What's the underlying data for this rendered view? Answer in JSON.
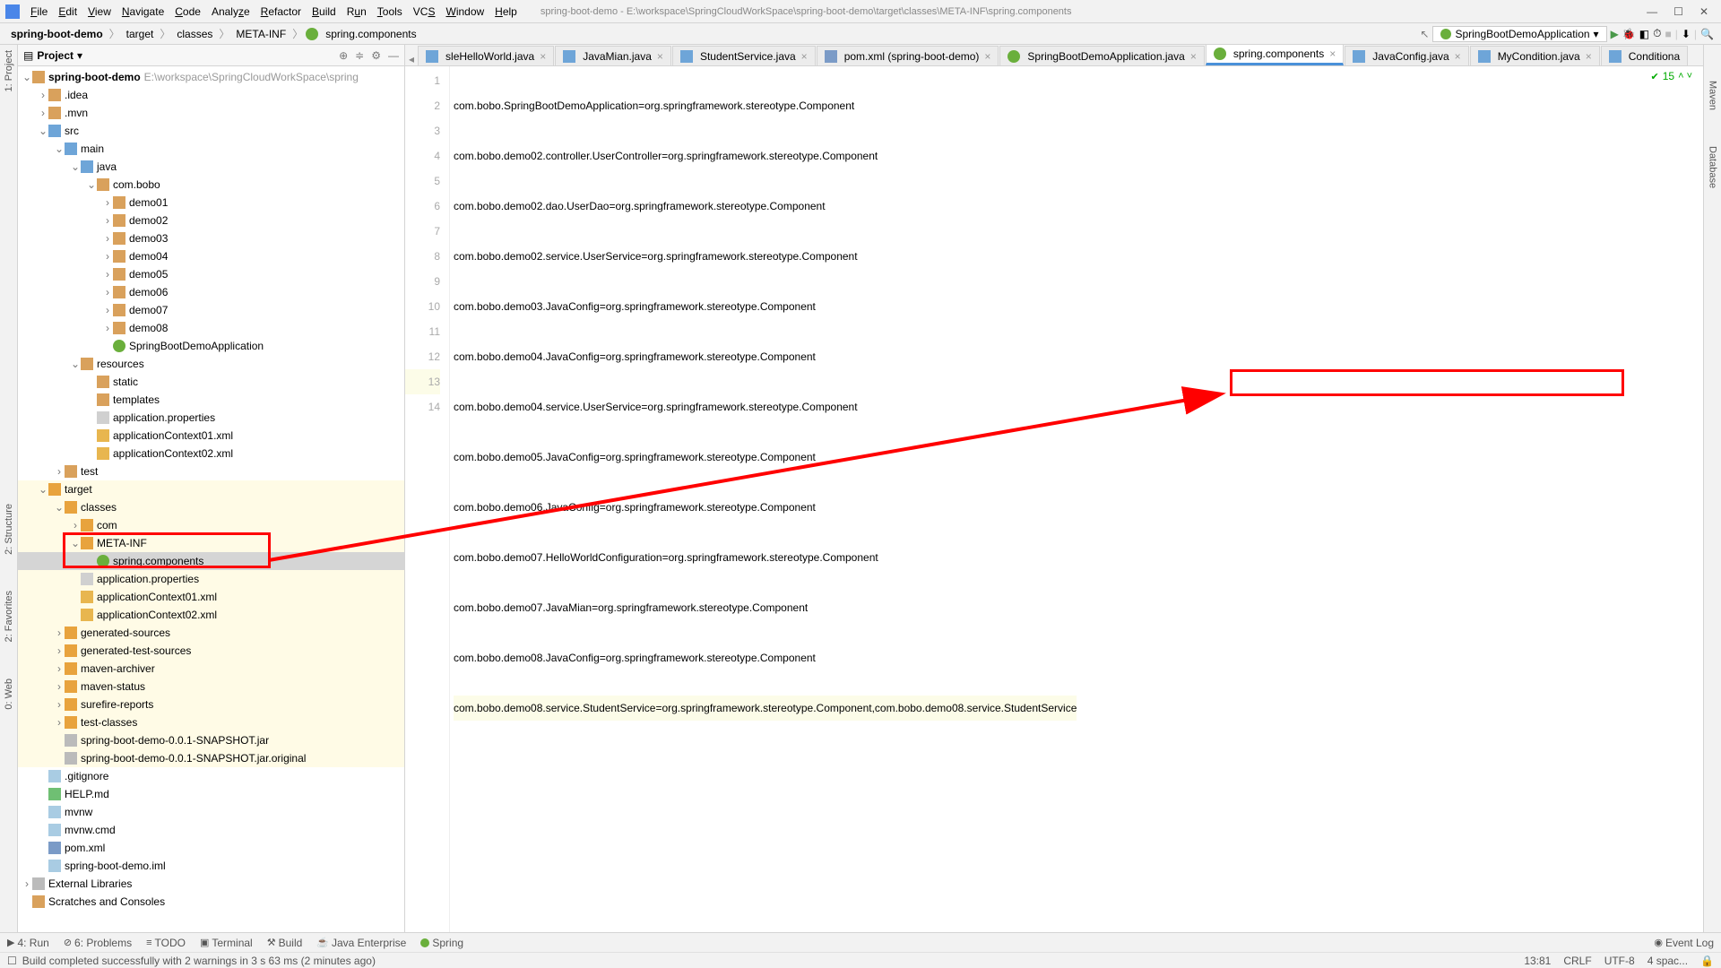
{
  "menu": [
    "File",
    "Edit",
    "View",
    "Navigate",
    "Code",
    "Analyze",
    "Refactor",
    "Build",
    "Run",
    "Tools",
    "VCS",
    "Window",
    "Help"
  ],
  "title_path": "spring-boot-demo - E:\\workspace\\SpringCloudWorkSpace\\spring-boot-demo\\target\\classes\\META-INF\\spring.components",
  "breadcrumbs": [
    "spring-boot-demo",
    "target",
    "classes",
    "META-INF",
    "spring.components"
  ],
  "run_config": "SpringBootDemoApplication",
  "project_panel_title": "Project",
  "tree": {
    "root": "spring-boot-demo",
    "root_path": "E:\\workspace\\SpringCloudWorkSpace\\spring",
    "idea": ".idea",
    "mvn": ".mvn",
    "src": "src",
    "main": "main",
    "java": "java",
    "combobo": "com.bobo",
    "demo01": "demo01",
    "demo02": "demo02",
    "demo03": "demo03",
    "demo04": "demo04",
    "demo05": "demo05",
    "demo06": "demo06",
    "demo07": "demo07",
    "demo08": "demo08",
    "sbapp": "SpringBootDemoApplication",
    "resources": "resources",
    "static": "static",
    "templates": "templates",
    "appprops": "application.properties",
    "ctx01": "applicationContext01.xml",
    "ctx02": "applicationContext02.xml",
    "test": "test",
    "target": "target",
    "classes": "classes",
    "com": "com",
    "metainf": "META-INF",
    "springcomp": "spring.components",
    "appprops2": "application.properties",
    "ctx01b": "applicationContext01.xml",
    "ctx02b": "applicationContext02.xml",
    "gensrc": "generated-sources",
    "gentest": "generated-test-sources",
    "march": "maven-archiver",
    "mstat": "maven-status",
    "sure": "surefire-reports",
    "tcls": "test-classes",
    "jar": "spring-boot-demo-0.0.1-SNAPSHOT.jar",
    "orig": "spring-boot-demo-0.0.1-SNAPSHOT.jar.original",
    "gitig": ".gitignore",
    "help": "HELP.md",
    "mvnw": "mvnw",
    "mvnwcmd": "mvnw.cmd",
    "pom": "pom.xml",
    "iml": "spring-boot-demo.iml",
    "extlib": "External Libraries",
    "scratch": "Scratches and Consoles"
  },
  "tabs": [
    {
      "label": "sleHelloWorld.java",
      "icon": "java"
    },
    {
      "label": "JavaMian.java",
      "icon": "java"
    },
    {
      "label": "StudentService.java",
      "icon": "java"
    },
    {
      "label": "pom.xml (spring-boot-demo)",
      "icon": "maven"
    },
    {
      "label": "SpringBootDemoApplication.java",
      "icon": "java"
    },
    {
      "label": "spring.components",
      "icon": "sb",
      "active": true
    },
    {
      "label": "JavaConfig.java",
      "icon": "java"
    },
    {
      "label": "MyCondition.java",
      "icon": "java"
    },
    {
      "label": "Conditiona",
      "icon": "java"
    }
  ],
  "editor_lines": [
    "com.bobo.SpringBootDemoApplication=org.springframework.stereotype.Component",
    "com.bobo.demo02.controller.UserController=org.springframework.stereotype.Component",
    "com.bobo.demo02.dao.UserDao=org.springframework.stereotype.Component",
    "com.bobo.demo02.service.UserService=org.springframework.stereotype.Component",
    "com.bobo.demo03.JavaConfig=org.springframework.stereotype.Component",
    "com.bobo.demo04.JavaConfig=org.springframework.stereotype.Component",
    "com.bobo.demo04.service.UserService=org.springframework.stereotype.Component",
    "com.bobo.demo05.JavaConfig=org.springframework.stereotype.Component",
    "com.bobo.demo06.JavaConfig=org.springframework.stereotype.Component",
    "com.bobo.demo07.HelloWorldConfiguration=org.springframework.stereotype.Component",
    "com.bobo.demo07.JavaMian=org.springframework.stereotype.Component",
    "com.bobo.demo08.JavaConfig=org.springframework.stereotype.Component",
    "com.bobo.demo08.service.StudentService=org.springframework.stereotype.Component,com.bobo.demo08.service.StudentService"
  ],
  "marker_count": "15",
  "left_tools": [
    "1: Project",
    "2: Structure",
    "2: Favorites",
    "0: Web"
  ],
  "right_tools": [
    "Maven",
    "Database"
  ],
  "bottom_tools": {
    "run": "4: Run",
    "problems": "6: Problems",
    "todo": "TODO",
    "terminal": "Terminal",
    "build": "Build",
    "javaee": "Java Enterprise",
    "spring": "Spring",
    "eventlog": "Event Log"
  },
  "status_msg": "Build completed successfully with 2 warnings in 3 s 63 ms (2 minutes ago)",
  "status_right": {
    "pos": "13:81",
    "crlf": "CRLF",
    "enc": "UTF-8",
    "indent": "4 spac..."
  }
}
